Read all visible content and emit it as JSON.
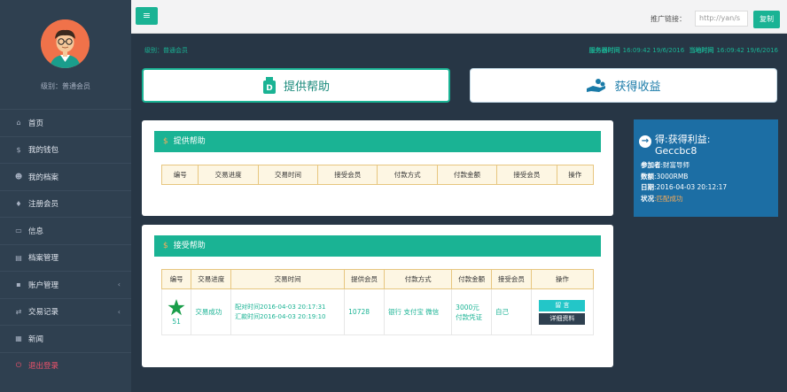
{
  "sidebar": {
    "user_level": "级别：普通会员",
    "items": [
      {
        "icon": "home-icon",
        "glyph": "⌂",
        "label": "首页",
        "chevron": ""
      },
      {
        "icon": "dollar-icon",
        "glyph": "$",
        "label": "我的钱包",
        "chevron": ""
      },
      {
        "icon": "user-icon",
        "glyph": "☻",
        "label": "我的档案",
        "chevron": ""
      },
      {
        "icon": "register-icon",
        "glyph": "♦",
        "label": "注册会员",
        "chevron": ""
      },
      {
        "icon": "folder-icon",
        "glyph": "▭",
        "label": "信息",
        "chevron": ""
      },
      {
        "icon": "archive-icon",
        "glyph": "▤",
        "label": "档案管理",
        "chevron": ""
      },
      {
        "icon": "lock-icon",
        "glyph": "▪",
        "label": "账户管理",
        "chevron": "‹"
      },
      {
        "icon": "exchange-icon",
        "glyph": "⇄",
        "label": "交易记录",
        "chevron": "‹"
      },
      {
        "icon": "news-icon",
        "glyph": "▦",
        "label": "新闻",
        "chevron": ""
      },
      {
        "icon": "power-icon",
        "glyph": "⏻",
        "label": "退出登录",
        "chevron": ""
      }
    ]
  },
  "topbar": {
    "menu_glyph": "≡",
    "ref_label": "推广链接：",
    "ref_value": "http://yan/s",
    "copy_label": "复制"
  },
  "content": {
    "breadcrumb": "级别：普通会员",
    "server_time_label": "服务器时间",
    "server_time": "16:09:42 19/6/2016",
    "current_time_label": "当地时间",
    "current_time": "16:09:42 19/6/2016"
  },
  "buttons": {
    "help": "提供帮助",
    "earn": "获得收益"
  },
  "help_panel": {
    "title": "提供帮助",
    "headers": [
      "编号",
      "交易进度",
      "交易时间",
      "接受会员",
      "付款方式",
      "付款金额",
      "接受会员",
      "操作"
    ]
  },
  "receive_panel": {
    "title": "接受帮助",
    "headers": [
      "编号",
      "交易进度",
      "交易时间",
      "提供会员",
      "付款方式",
      "付款金额",
      "接受会员",
      "操作"
    ],
    "row": {
      "id": "51",
      "status": "交易成功",
      "time1": "配对时间2016-04-03 20:17:31",
      "time2": "汇款时间2016-04-03 20:19:10",
      "provider": "10728",
      "payment": "银行 支付宝 微信",
      "amount1": "3000元",
      "amount2": "付款凭证",
      "receiver": "自己",
      "btn1": "留 言",
      "btn2": "详细资料"
    }
  },
  "side_card": {
    "title1": "得:获得利益:",
    "title2": "Geccbc8",
    "row1_label": "参加者",
    "row1_value": ":财富导师",
    "row2_label": "数额",
    "row2_value": ":3000RMB",
    "row3_label": "日期",
    "row3_value": ":2016-04-03 20:12:17",
    "row4_label": "状况",
    "row4_value": ":匹配成功"
  }
}
